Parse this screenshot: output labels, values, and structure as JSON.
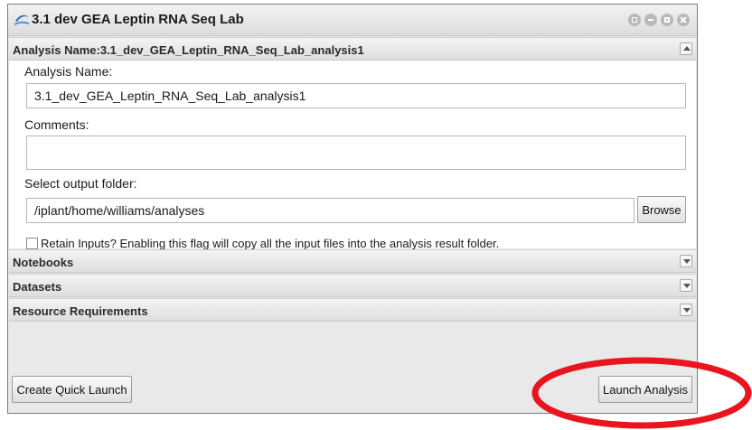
{
  "window": {
    "title": "3.1 dev GEA Leptin RNA Seq Lab",
    "controls": [
      "grid-icon",
      "minimize-icon",
      "maximize-icon",
      "close-icon"
    ]
  },
  "analysis_section": {
    "header": "Analysis Name:3.1_dev_GEA_Leptin_RNA_Seq_Lab_analysis1",
    "name_label": "Analysis Name:",
    "name_value": "3.1_dev_GEA_Leptin_RNA_Seq_Lab_analysis1",
    "comments_label": "Comments:",
    "comments_value": "",
    "output_label": "Select output folder:",
    "output_value": "/iplant/home/williams/analyses",
    "browse_label": "Browse",
    "retain_label": "Retain Inputs? Enabling this flag will copy all the input files into the analysis result folder.",
    "retain_checked": false
  },
  "sections": {
    "notebooks": "Notebooks",
    "datasets": "Datasets",
    "resources": "Resource Requirements"
  },
  "footer": {
    "quick_launch": "Create Quick Launch",
    "launch": "Launch Analysis"
  },
  "colors": {
    "highlight_ellipse": "#e8141e"
  }
}
